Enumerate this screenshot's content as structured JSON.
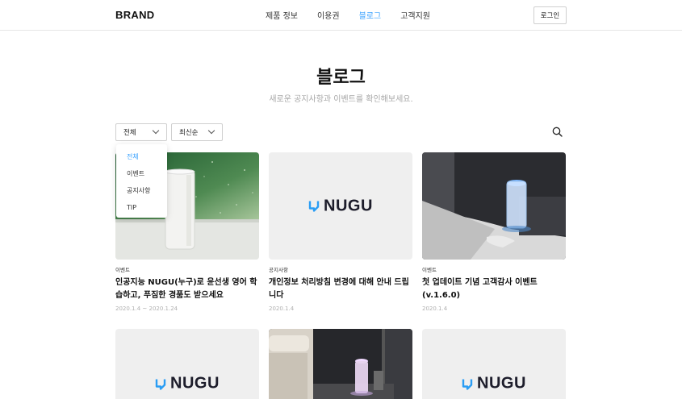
{
  "header": {
    "brand": "BRAND",
    "nav": [
      "제품 정보",
      "이용권",
      "블로그",
      "고객지원"
    ],
    "active_nav": "블로그",
    "login_label": "로그인"
  },
  "page": {
    "title": "블로그",
    "subtitle": "새로운 공지사항과 이벤트를 확인해보세요."
  },
  "filters": {
    "category": "전체",
    "sort": "최신순",
    "category_options": [
      "전체",
      "이벤트",
      "공지사항",
      "TIP"
    ]
  },
  "search_icon": "search-icon",
  "posts": [
    {
      "image": "speaker-by-window",
      "category": "이벤트",
      "title_line1": "인공지능 NUGU(누구)로 윤선생 영어 학",
      "title_line2": "습하고, 푸짐한 경품도 받으세요",
      "date": "2020.1.4 ~ 2020.1.24"
    },
    {
      "image": "nugu-logo",
      "category": "공지사항",
      "title_line1": "개인정보 처리방침 변경에 대해 안내 드립",
      "title_line2": "니다",
      "date": "2020.1.4"
    },
    {
      "image": "speaker-bedside",
      "category": "이벤트",
      "title_line1": "첫 업데이트 기념 고객감사 이벤트",
      "title_line2": "(v.1.6.0)",
      "date": "2020.1.4"
    }
  ],
  "second_row": [
    {
      "image": "nugu-logo"
    },
    {
      "image": "speaker-bedroom-night"
    },
    {
      "image": "nugu-logo"
    }
  ],
  "logo_text": "NUGU",
  "colors": {
    "accent": "#3ba3ff",
    "nugu_mark": "#2a9df4"
  }
}
